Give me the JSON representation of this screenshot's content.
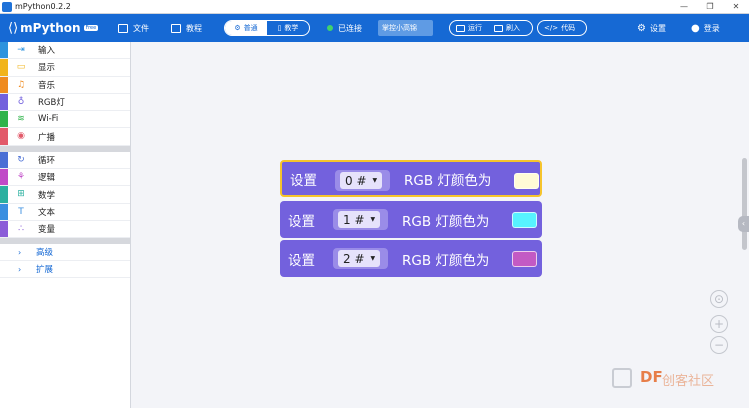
{
  "window": {
    "title": "mPython0.2.2",
    "controls": [
      "—",
      "❐",
      "✕"
    ]
  },
  "toolbar": {
    "logo": "mPython",
    "logo_badge": "Free",
    "file": "文件",
    "tutorial": "教程",
    "mode_normal": "普通",
    "mode_teach": "教学",
    "status": "已连接",
    "device": "掌控小高锦",
    "run": "运行",
    "flash": "刷入",
    "code": "代码",
    "settings": "设置",
    "login": "登录"
  },
  "sidebar": {
    "group1": [
      {
        "label": "输入",
        "color": "#2d93de",
        "icon": "⇥"
      },
      {
        "label": "显示",
        "color": "#f1b41b",
        "icon": "▭"
      },
      {
        "label": "音乐",
        "color": "#ef8b20",
        "icon": "♫"
      },
      {
        "label": "RGB灯",
        "color": "#7361dd",
        "icon": "♁"
      },
      {
        "label": "Wi-Fi",
        "color": "#2fb34a",
        "icon": "≋"
      },
      {
        "label": "广播",
        "color": "#e25a6a",
        "icon": "◉"
      }
    ],
    "group2": [
      {
        "label": "循环",
        "color": "#4a6fd5",
        "icon": "↻"
      },
      {
        "label": "逻辑",
        "color": "#c04ac7",
        "icon": "⚘"
      },
      {
        "label": "数学",
        "color": "#2bb0a0",
        "icon": "⊞"
      },
      {
        "label": "文本",
        "color": "#3b8fe0",
        "icon": "T"
      },
      {
        "label": "变量",
        "color": "#8b5cd8",
        "icon": "∴"
      }
    ],
    "advanced": "高级",
    "extend": "扩展"
  },
  "blocks": [
    {
      "set": "设置",
      "index": "0 #",
      "text": "RGB 灯颜色为",
      "color": "#fffbd6"
    },
    {
      "set": "设置",
      "index": "1 #",
      "text": "RGB 灯颜色为",
      "color": "#57f2ff"
    },
    {
      "set": "设置",
      "index": "2 #",
      "text": "RGB 灯颜色为",
      "color": "#c35ac4"
    }
  ],
  "workspace": {
    "zoom_in": "+",
    "zoom_out": "−"
  },
  "watermark": {
    "brand": "DF",
    "text": "创客社区"
  }
}
